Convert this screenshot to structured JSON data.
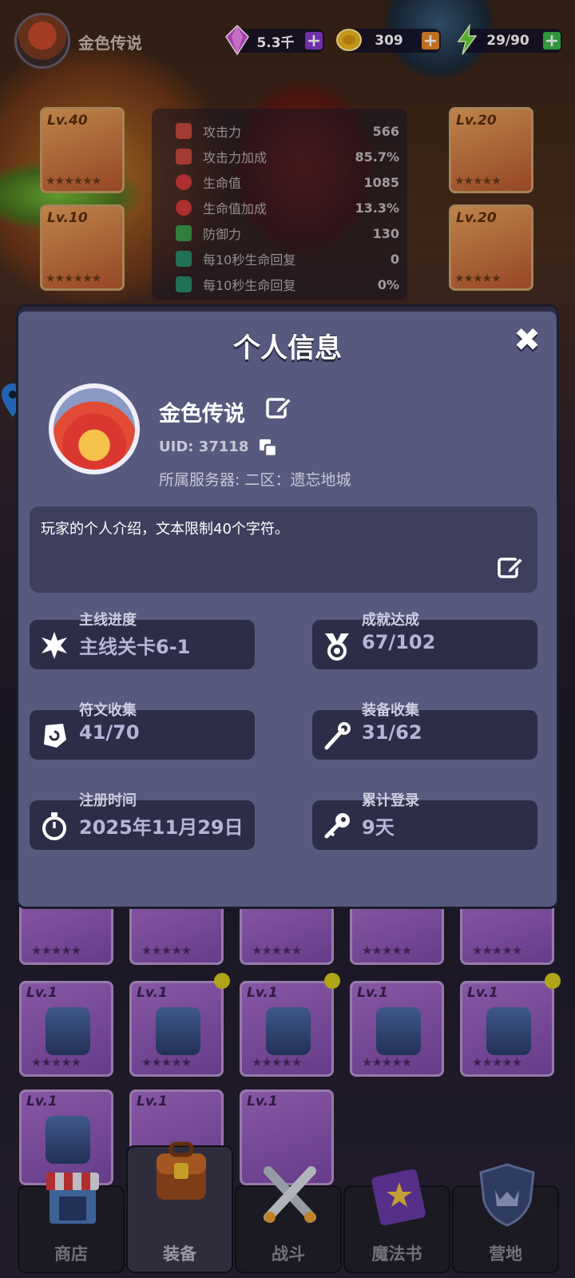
{
  "header": {
    "player_name": "金色传说",
    "gems": "5.3千",
    "coins": "309",
    "energy": "29/90"
  },
  "stats": [
    {
      "label": "攻击力",
      "value": "566",
      "color": "#c44a3e"
    },
    {
      "label": "攻击力加成",
      "value": "85.7%",
      "color": "#c44a3e"
    },
    {
      "label": "生命值",
      "value": "1085",
      "color": "#d43a3a"
    },
    {
      "label": "生命值加成",
      "value": "13.3%",
      "color": "#d43a3a"
    },
    {
      "label": "防御力",
      "value": "130",
      "color": "#3a9a4a"
    },
    {
      "label": "每10秒生命回复",
      "value": "0",
      "color": "#2a8a6a"
    },
    {
      "label": "每10秒生命回复",
      "value": "0%",
      "color": "#2a8a6a"
    }
  ],
  "equipment": [
    {
      "level": "Lv.40",
      "stars": "★★★★★★"
    },
    {
      "level": "Lv.10",
      "stars": "★★★★★★"
    },
    {
      "level": "Lv.20",
      "stars": "★★★★★"
    },
    {
      "level": "Lv.20",
      "stars": "★★★★★"
    }
  ],
  "modal": {
    "title": "个人信息",
    "close_icon": "✖",
    "name": "金色传说",
    "uid": "UID: 37118",
    "server": "所属服务器: 二区：遗忘地城",
    "bio": "玩家的个人介绍，文本限制40个字符。",
    "cards": [
      {
        "label": "主线进度",
        "value": "主线关卡6-1",
        "icon": "star-burst-icon"
      },
      {
        "label": "成就达成",
        "value": "67/102",
        "icon": "medal-icon"
      },
      {
        "label": "符文收集",
        "value": "41/70",
        "icon": "rune-icon"
      },
      {
        "label": "装备收集",
        "value": "31/62",
        "icon": "staff-icon"
      },
      {
        "label": "注册时间",
        "value": "2025年11月29日",
        "icon": "stopwatch-icon"
      },
      {
        "label": "累计登录",
        "value": "9天",
        "icon": "key-icon"
      }
    ]
  },
  "inventory_row1": {
    "stars": "★★★★★"
  },
  "inventory": [
    {
      "level": "Lv.1",
      "stars": "★★★★★"
    },
    {
      "level": "Lv.1",
      "stars": "★★★★★"
    },
    {
      "level": "Lv.1",
      "stars": "★★★★★"
    },
    {
      "level": "Lv.1",
      "stars": "★★★★★"
    },
    {
      "level": "Lv.1",
      "stars": "★★★★★"
    },
    {
      "level": "Lv.1"
    },
    {
      "level": "Lv.1"
    },
    {
      "level": "Lv.1"
    }
  ],
  "nav": [
    {
      "label": "商店"
    },
    {
      "label": "装备"
    },
    {
      "label": "战斗"
    },
    {
      "label": "魔法书"
    },
    {
      "label": "营地"
    }
  ]
}
